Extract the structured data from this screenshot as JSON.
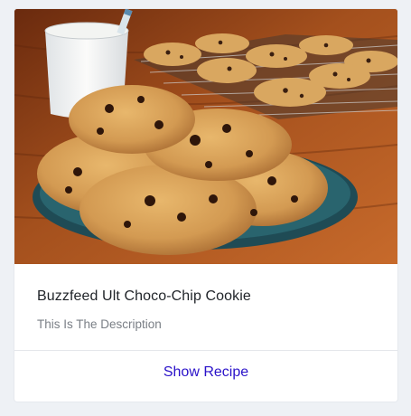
{
  "card": {
    "image_alt": "Plate of chocolate chip cookies with a glass of milk on a wooden table",
    "title": "Buzzfeed Ult Choco-Chip Cookie",
    "description": "This Is The Description",
    "action_label": "Show Recipe"
  },
  "colors": {
    "page_background": "#eef1f5",
    "card_background": "#ffffff",
    "title": "#1f2328",
    "description": "#7a7f86",
    "link": "#2a12c9",
    "divider": "#e5e7eb"
  }
}
